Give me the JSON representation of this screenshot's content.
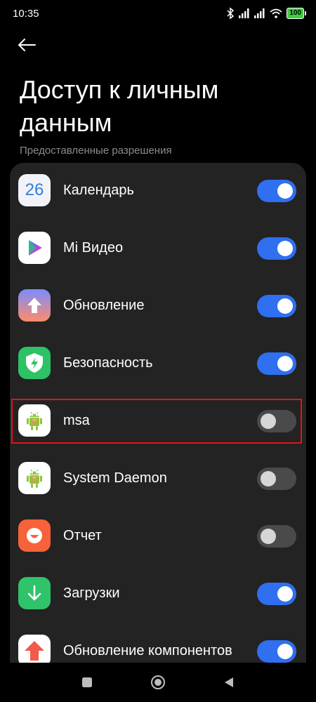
{
  "status": {
    "time": "10:35",
    "battery": "100"
  },
  "header": {
    "title": "Доступ к личным данным"
  },
  "section": {
    "label": "Предоставленные разрешения"
  },
  "items": [
    {
      "name": "Календарь",
      "enabled": true,
      "icon": "calendar-icon",
      "icon_text": "26"
    },
    {
      "name": "Mi Видео",
      "enabled": true,
      "icon": "mi-video-icon"
    },
    {
      "name": "Обновление",
      "enabled": true,
      "icon": "update-icon"
    },
    {
      "name": "Безопасность",
      "enabled": true,
      "icon": "security-icon"
    },
    {
      "name": "msa",
      "enabled": false,
      "icon": "android-icon",
      "highlighted": true
    },
    {
      "name": "System Daemon",
      "enabled": false,
      "icon": "android-icon"
    },
    {
      "name": "Отчет",
      "enabled": false,
      "icon": "report-icon"
    },
    {
      "name": "Загрузки",
      "enabled": true,
      "icon": "downloads-icon"
    },
    {
      "name": "Обновление компонентов",
      "enabled": true,
      "icon": "component-update-icon"
    }
  ],
  "colors": {
    "toggle_on": "#2f6ff0",
    "toggle_off": "#4a4a4a",
    "highlight": "#e0141a",
    "card": "#232323"
  }
}
